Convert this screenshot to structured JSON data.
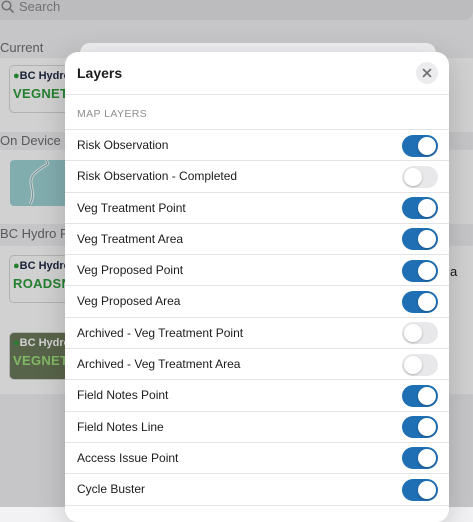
{
  "background": {
    "search_placeholder": "Search",
    "sections": [
      {
        "label": "Current"
      },
      {
        "label": "On Device"
      },
      {
        "label": "BC Hydro Ro"
      }
    ],
    "cards": [
      {
        "brand": "BC Hydro",
        "sub": "VEGNET",
        "sub_color": "#2d9b3a"
      },
      {
        "brand": "",
        "sub": ""
      },
      {
        "brand": "BC Hydro",
        "sub": "ROADSNI",
        "sub_color": "#2d9b3a"
      },
      {
        "brand": "BC Hydro",
        "sub": "VEGNET",
        "sub_color": "#9ee27a"
      }
    ],
    "peek_text": "a"
  },
  "modal": {
    "title": "Layers",
    "close_icon": "close-icon",
    "section_header": "MAP LAYERS",
    "layers": [
      {
        "label": "Risk Observation",
        "enabled": true
      },
      {
        "label": "Risk Observation - Completed",
        "enabled": false
      },
      {
        "label": "Veg Treatment Point",
        "enabled": true
      },
      {
        "label": "Veg Treatment Area",
        "enabled": true
      },
      {
        "label": "Veg Proposed Point",
        "enabled": true
      },
      {
        "label": "Veg Proposed Area",
        "enabled": true
      },
      {
        "label": "Archived - Veg Treatment Point",
        "enabled": false
      },
      {
        "label": "Archived - Veg Treatment Area",
        "enabled": false
      },
      {
        "label": "Field Notes Point",
        "enabled": true
      },
      {
        "label": "Field Notes Line",
        "enabled": true
      },
      {
        "label": "Access Issue Point",
        "enabled": true
      },
      {
        "label": "Cycle Buster",
        "enabled": true
      }
    ]
  },
  "colors": {
    "toggle_on": "#1f6fb4",
    "toggle_off": "#e8e8ea"
  }
}
